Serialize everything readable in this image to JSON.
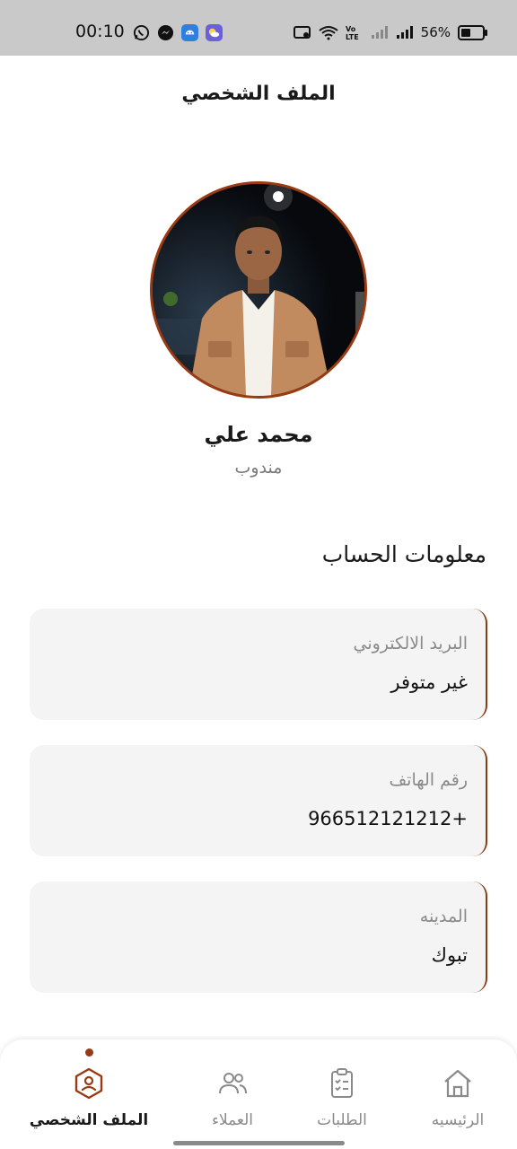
{
  "status_bar": {
    "time": "00:10",
    "battery_text": "56%",
    "battery_level": 0.56,
    "apps": [
      "whatsapp-icon",
      "messenger-icon",
      "android-app-icon",
      "weather-app-icon"
    ],
    "indicators": [
      "cast-icon",
      "wifi-icon",
      "volte-icon",
      "signal-1-icon",
      "signal-2-icon",
      "battery-icon"
    ]
  },
  "header": {
    "title": "الملف الشخصي"
  },
  "profile": {
    "name": "محمد علي",
    "role": "مندوب"
  },
  "account": {
    "section_title": "معلومات الحساب",
    "fields": [
      {
        "label": "البريد الالكتروني",
        "value": "غير متوفر"
      },
      {
        "label": "رقم الهاتف",
        "value": "966512121212+"
      },
      {
        "label": "المدينه",
        "value": "تبوك"
      }
    ]
  },
  "bottom_nav": {
    "items": [
      {
        "label": "الملف الشخصي",
        "icon": "profile-icon",
        "active": true
      },
      {
        "label": "العملاء",
        "icon": "users-icon",
        "active": false
      },
      {
        "label": "الطلبات",
        "icon": "clipboard-icon",
        "active": false
      },
      {
        "label": "الرئيسيه",
        "icon": "home-icon",
        "active": false
      }
    ]
  },
  "colors": {
    "accent": "#9a3a12",
    "card_bg": "#f4f4f4",
    "status_bar_bg": "#c9c9c9"
  }
}
